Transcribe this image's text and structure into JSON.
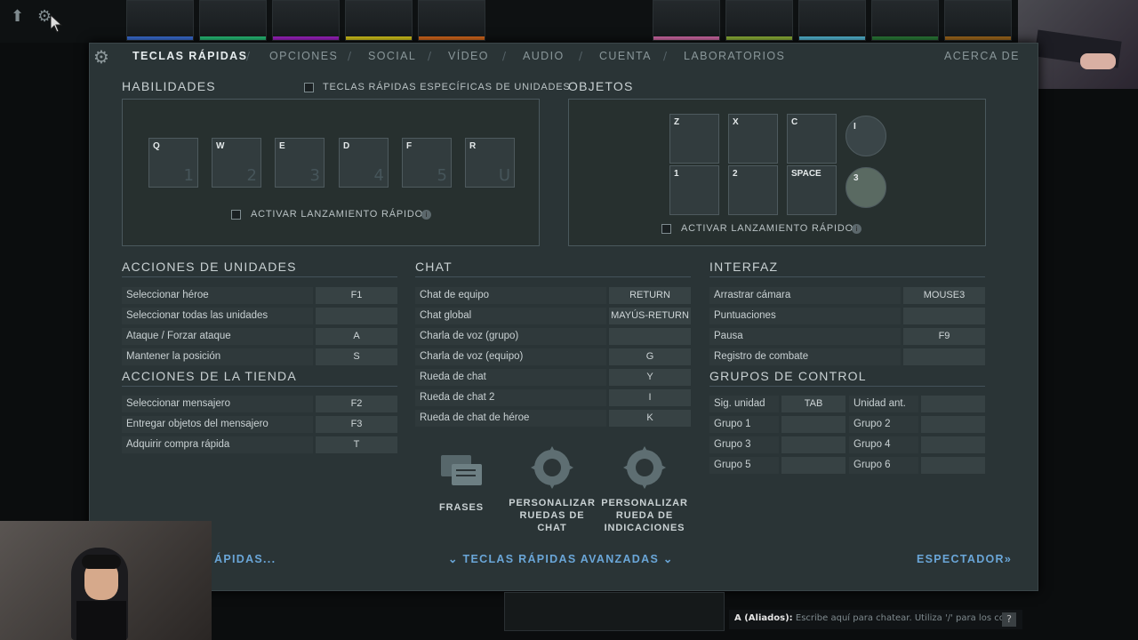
{
  "nav": {
    "tabs": [
      "TECLAS RÁPIDAS",
      "OPCIONES",
      "SOCIAL",
      "VÍDEO",
      "AUDIO",
      "CUENTA",
      "LABORATORIOS"
    ],
    "right_link": "ACERCA DE"
  },
  "habilidades": {
    "title": "HABILIDADES",
    "unit_specific_label": "TECLAS RÁPIDAS ESPECÍFICAS DE UNIDADES",
    "keys": [
      {
        "label": "Q",
        "ghost": "1"
      },
      {
        "label": "W",
        "ghost": "2"
      },
      {
        "label": "E",
        "ghost": "3"
      },
      {
        "label": "D",
        "ghost": "4"
      },
      {
        "label": "F",
        "ghost": "5"
      },
      {
        "label": "R",
        "ghost": "U"
      }
    ],
    "quickcast_label": "ACTIVAR LANZAMIENTO RÁPIDO"
  },
  "objetos": {
    "title": "OBJETOS",
    "row1": [
      "Z",
      "X",
      "C",
      "I"
    ],
    "row2": [
      "1",
      "2",
      "SPACE",
      "3"
    ],
    "quickcast_label": "ACTIVAR LANZAMIENTO RÁPIDO"
  },
  "unidades": {
    "title": "ACCIONES DE UNIDADES",
    "rows": [
      {
        "label": "Seleccionar héroe",
        "key": "F1"
      },
      {
        "label": "Seleccionar todas las unidades",
        "key": ""
      },
      {
        "label": "Ataque / Forzar ataque",
        "key": "A"
      },
      {
        "label": "Mantener la posición",
        "key": "S"
      }
    ]
  },
  "tienda": {
    "title": "ACCIONES DE LA TIENDA",
    "rows": [
      {
        "label": "Seleccionar mensajero",
        "key": "F2"
      },
      {
        "label": "Entregar objetos del mensajero",
        "key": "F3"
      },
      {
        "label": "Adquirir compra rápida",
        "key": "T"
      }
    ]
  },
  "chat": {
    "title": "CHAT",
    "rows": [
      {
        "label": "Chat de equipo",
        "key": "RETURN"
      },
      {
        "label": "Chat global",
        "key": "MAYÚS-RETURN"
      },
      {
        "label": "Charla de voz (grupo)",
        "key": ""
      },
      {
        "label": "Charla de voz (equipo)",
        "key": "G"
      },
      {
        "label": "Rueda de chat",
        "key": "Y"
      },
      {
        "label": "Rueda de chat 2",
        "key": "I"
      },
      {
        "label": "Rueda de chat de héroe",
        "key": "K"
      }
    ]
  },
  "interfaz": {
    "title": "INTERFAZ",
    "rows": [
      {
        "label": "Arrastrar cámara",
        "key": "MOUSE3"
      },
      {
        "label": "Puntuaciones",
        "key": ""
      },
      {
        "label": "Pausa",
        "key": "F9"
      },
      {
        "label": "Registro de combate",
        "key": ""
      }
    ]
  },
  "grupos": {
    "title": "GRUPOS DE CONTROL",
    "left": [
      {
        "label": "Sig. unidad",
        "key": "TAB"
      },
      {
        "label": "Grupo 1",
        "key": ""
      },
      {
        "label": "Grupo 3",
        "key": ""
      },
      {
        "label": "Grupo 5",
        "key": ""
      }
    ],
    "right": [
      {
        "label": "Unidad ant.",
        "key": ""
      },
      {
        "label": "Grupo 2",
        "key": ""
      },
      {
        "label": "Grupo 4",
        "key": ""
      },
      {
        "label": "Grupo 6",
        "key": ""
      }
    ]
  },
  "buttons": {
    "frases": "FRASES",
    "ruedas_chat": "PERSONALIZAR RUEDAS DE CHAT",
    "rueda_indic": "PERSONALIZAR RUEDA DE INDICACIONES"
  },
  "footer": {
    "left": "ÁPIDAS...",
    "center": "TECLAS RÁPIDAS AVANZADAS",
    "right": "ESPECTADOR"
  },
  "chatbar": {
    "channel": "A (Aliados):",
    "placeholder": "Escribe aquí para chatear. Utiliza '/' para los co..."
  },
  "colors": {
    "accent": "#6aa6d8",
    "hero_bars": [
      "#3b6fd6",
      "#29c07a",
      "#a023c7",
      "#d8c81c",
      "#d9691d",
      "#d46ba8",
      "#8fb33a",
      "#54b9d6",
      "#2a7c3a",
      "#a26a1d"
    ]
  }
}
